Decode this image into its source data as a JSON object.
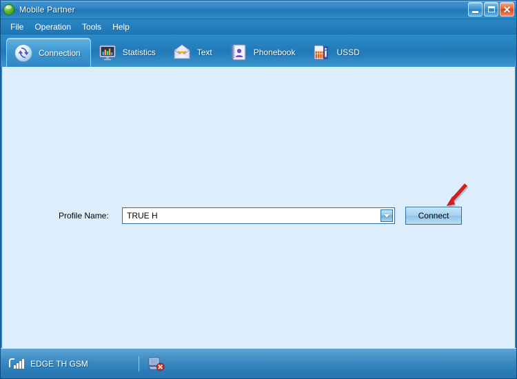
{
  "window": {
    "title": "Mobile Partner",
    "app_icon": "app-globe-icon",
    "controls": {
      "minimize_label": "Minimize",
      "maximize_label": "Maximize",
      "close_label": "Close",
      "close_glyph": "✕"
    }
  },
  "menu": {
    "items": [
      {
        "label": "File"
      },
      {
        "label": "Operation"
      },
      {
        "label": "Tools"
      },
      {
        "label": "Help"
      }
    ]
  },
  "toolbar": {
    "tabs": [
      {
        "label": "Connection",
        "icon": "refresh-circle-icon",
        "active": true
      },
      {
        "label": "Statistics",
        "icon": "monitor-chart-icon",
        "active": false
      },
      {
        "label": "Text",
        "icon": "envelope-icon",
        "active": false
      },
      {
        "label": "Phonebook",
        "icon": "address-book-icon",
        "active": false
      },
      {
        "label": "USSD",
        "icon": "sim-card-info-icon",
        "active": false
      }
    ]
  },
  "main": {
    "profile": {
      "label": "Profile Name:",
      "value": "TRUE H",
      "placeholder": "",
      "dropdown_icon": "chevron-down-icon"
    },
    "connect_button": {
      "label": "Connect"
    },
    "annotation": {
      "type": "red-callout-arrow",
      "points_to": "connect-button",
      "color": "#d1201f"
    }
  },
  "status_bar": {
    "signal_icon": "signal-bars-icon",
    "network_text": "EDGE  TH GSM",
    "connection_icon": "disconnected-computer-icon"
  },
  "colors": {
    "title_bar": "#2f85c4",
    "menu_bar": "#2179b7",
    "toolbar": "#2179b7",
    "content_bg": "#dceefb",
    "status_bar": "#3e8cc4",
    "accent_border": "#2b6ca3",
    "annotation_red": "#d1201f",
    "button_face": "#a6d2ef"
  }
}
